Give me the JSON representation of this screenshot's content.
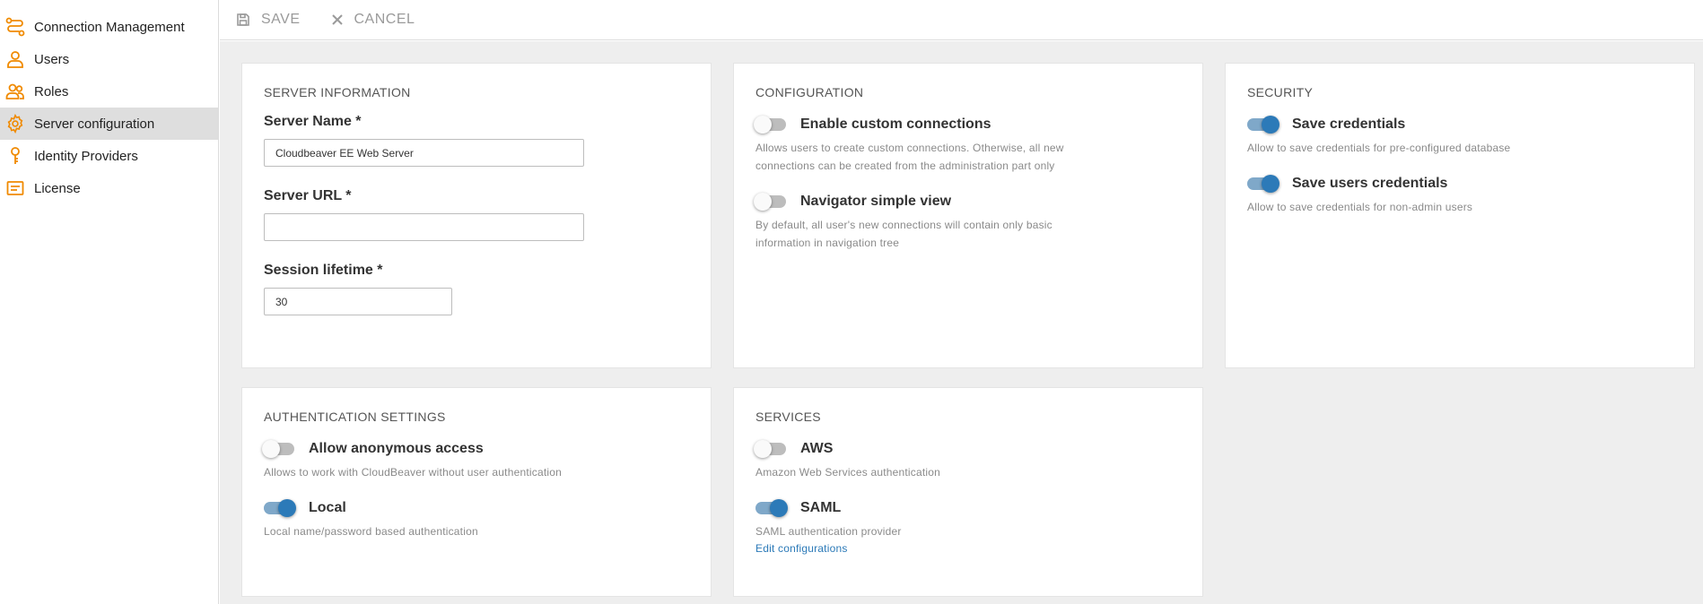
{
  "sidebar": {
    "items": [
      {
        "label": "Connection Management",
        "icon": "connection-icon"
      },
      {
        "label": "Users",
        "icon": "user-icon"
      },
      {
        "label": "Roles",
        "icon": "roles-icon"
      },
      {
        "label": "Server configuration",
        "icon": "gear-icon",
        "active": true
      },
      {
        "label": "Identity Providers",
        "icon": "key-icon"
      },
      {
        "label": "License",
        "icon": "license-icon"
      }
    ]
  },
  "toolbar": {
    "save_label": "SAVE",
    "cancel_label": "CANCEL"
  },
  "server_info": {
    "title": "SERVER INFORMATION",
    "server_name_label": "Server Name *",
    "server_name_value": "Cloudbeaver EE Web Server",
    "server_url_label": "Server URL *",
    "server_url_value": "",
    "session_lifetime_label": "Session lifetime *",
    "session_lifetime_value": "30"
  },
  "configuration": {
    "title": "CONFIGURATION",
    "options": [
      {
        "label": "Enable custom connections",
        "enabled": false,
        "desc1": "Allows users to create custom connections. Otherwise, all new",
        "desc2": "connections can be created from the administration part only"
      },
      {
        "label": "Navigator simple view",
        "enabled": false,
        "desc1": "By default, all user's new connections will contain only basic",
        "desc2": "information in navigation tree"
      }
    ]
  },
  "security": {
    "title": "SECURITY",
    "options": [
      {
        "label": "Save credentials",
        "enabled": true,
        "desc": "Allow to save credentials for pre-configured database"
      },
      {
        "label": "Save users credentials",
        "enabled": true,
        "desc": "Allow to save credentials for non-admin users"
      }
    ]
  },
  "auth_settings": {
    "title": "AUTHENTICATION SETTINGS",
    "options": [
      {
        "label": "Allow anonymous access",
        "enabled": false,
        "desc": "Allows to work with CloudBeaver without user authentication"
      },
      {
        "label": "Local",
        "enabled": true,
        "desc": "Local name/password based authentication"
      }
    ]
  },
  "services": {
    "title": "SERVICES",
    "options": [
      {
        "label": "AWS",
        "enabled": false,
        "desc": "Amazon Web Services authentication"
      },
      {
        "label": "SAML",
        "enabled": true,
        "desc": "SAML authentication provider",
        "link": "Edit configurations"
      }
    ]
  },
  "colors": {
    "accent": "#f08a00",
    "toggle_on": "#2c7ab8",
    "toggle_track_on": "#7fa8c9",
    "toggle_off": "#bdbdbd",
    "link": "#2c7ab8"
  }
}
